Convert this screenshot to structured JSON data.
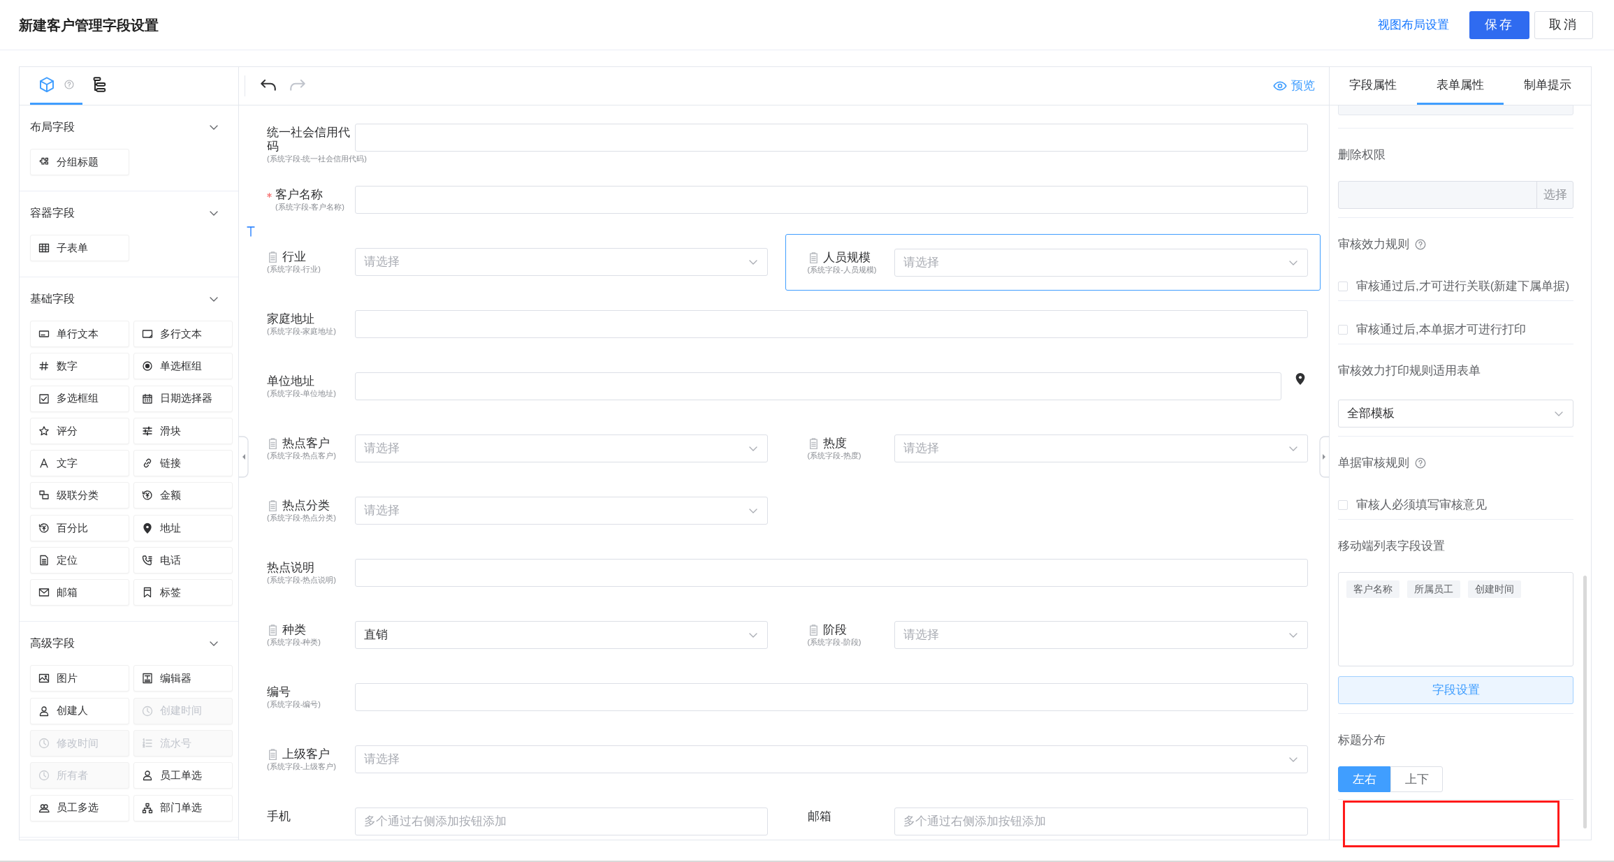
{
  "header": {
    "title": "新建客户管理字段设置",
    "actions": [
      {
        "label": "视图布局设置",
        "kind": "link"
      },
      {
        "label": "保存",
        "kind": "primary"
      },
      {
        "label": "取消",
        "kind": "default"
      }
    ]
  },
  "palette": {
    "tabs": [
      {
        "kind": "components",
        "selected": true
      },
      {
        "kind": "outline",
        "selected": false
      }
    ],
    "sections": [
      {
        "title": "布局字段",
        "expanded": true,
        "items": [
          {
            "label": "分组标题",
            "kind": "puzzle",
            "disabled": false
          }
        ]
      },
      {
        "title": "容器字段",
        "expanded": true,
        "items": [
          {
            "label": "子表单",
            "kind": "table",
            "disabled": false
          }
        ]
      },
      {
        "title": "基础字段",
        "expanded": true,
        "items": [
          {
            "label": "单行文本",
            "kind": "textline",
            "disabled": false
          },
          {
            "label": "多行文本",
            "kind": "textarea",
            "disabled": false
          },
          {
            "label": "数字",
            "kind": "number",
            "disabled": false
          },
          {
            "label": "单选框组",
            "kind": "radio",
            "disabled": false
          },
          {
            "label": "多选框组",
            "kind": "checkbox",
            "disabled": false
          },
          {
            "label": "日期选择器",
            "kind": "calendar",
            "disabled": false
          },
          {
            "label": "评分",
            "kind": "star",
            "disabled": false
          },
          {
            "label": "滑块",
            "kind": "sliders",
            "disabled": false
          },
          {
            "label": "文字",
            "kind": "font",
            "disabled": false
          },
          {
            "label": "链接",
            "kind": "link",
            "disabled": false
          },
          {
            "label": "级联分类",
            "kind": "cascade",
            "disabled": false
          },
          {
            "label": "金额",
            "kind": "money",
            "disabled": false
          },
          {
            "label": "百分比",
            "kind": "money",
            "disabled": false
          },
          {
            "label": "地址",
            "kind": "pin",
            "disabled": false
          },
          {
            "label": "定位",
            "kind": "document",
            "disabled": false
          },
          {
            "label": "电话",
            "kind": "phone",
            "disabled": false
          },
          {
            "label": "邮箱",
            "kind": "mail",
            "disabled": false
          },
          {
            "label": "标签",
            "kind": "bookmark",
            "disabled": false
          }
        ]
      },
      {
        "title": "高级字段",
        "expanded": true,
        "items": [
          {
            "label": "图片",
            "kind": "image",
            "disabled": false
          },
          {
            "label": "编辑器",
            "kind": "editor",
            "disabled": false
          },
          {
            "label": "创建人",
            "kind": "user",
            "disabled": false
          },
          {
            "label": "创建时间",
            "kind": "clock",
            "disabled": true
          },
          {
            "label": "修改时间",
            "kind": "clock",
            "disabled": true
          },
          {
            "label": "流水号",
            "kind": "numbered",
            "disabled": true
          },
          {
            "label": "所有者",
            "kind": "clock",
            "disabled": true
          },
          {
            "label": "员工单选",
            "kind": "user",
            "disabled": false
          },
          {
            "label": "员工多选",
            "kind": "users",
            "disabled": false
          },
          {
            "label": "部门单选",
            "kind": "org",
            "disabled": false
          }
        ]
      }
    ]
  },
  "canvas": {
    "preview": "预览",
    "rows": [
      [
        {
          "kind": "text",
          "full_width": true,
          "label": "统一社会信用代码",
          "note": "(系统字段-统一社会信用代码)",
          "required": false,
          "selected": false
        }
      ],
      [
        {
          "kind": "text",
          "full_width": true,
          "label": "客户名称",
          "note": "(系统字段-客户名称)",
          "required": true,
          "selected": false
        }
      ],
      [
        {
          "kind": "select",
          "full_width": false,
          "label": "行业",
          "note": "(系统字段-行业)",
          "placeholder": "请选择",
          "required": false,
          "selected": false
        },
        {
          "kind": "select",
          "full_width": false,
          "label": "人员规模",
          "note": "(系统字段-人员规模)",
          "placeholder": "请选择",
          "required": false,
          "selected": true
        }
      ],
      [
        {
          "kind": "text",
          "full_width": true,
          "label": "家庭地址",
          "note": "(系统字段-家庭地址)",
          "required": false,
          "selected": false
        }
      ],
      [
        {
          "kind": "address",
          "full_width": true,
          "label": "单位地址",
          "note": "(系统字段-单位地址)",
          "required": false,
          "selected": false
        }
      ],
      [
        {
          "kind": "select",
          "full_width": false,
          "label": "热点客户",
          "note": "(系统字段-热点客户)",
          "placeholder": "请选择",
          "required": false,
          "selected": false
        },
        {
          "kind": "select",
          "full_width": false,
          "label": "热度",
          "note": "(系统字段-热度)",
          "placeholder": "请选择",
          "required": false,
          "selected": false
        }
      ],
      [
        {
          "kind": "select",
          "full_width": false,
          "label": "热点分类",
          "note": "(系统字段-热点分类)",
          "placeholder": "请选择",
          "required": false,
          "selected": false
        }
      ],
      [
        {
          "kind": "text",
          "full_width": true,
          "label": "热点说明",
          "note": "(系统字段-热点说明)",
          "required": false,
          "selected": false
        }
      ],
      [
        {
          "kind": "select",
          "full_width": false,
          "label": "种类",
          "note": "(系统字段-种类)",
          "value": "直销",
          "required": false,
          "selected": false
        },
        {
          "kind": "select",
          "full_width": false,
          "label": "阶段",
          "note": "(系统字段-阶段)",
          "placeholder": "请选择",
          "required": false,
          "selected": false
        }
      ],
      [
        {
          "kind": "text",
          "full_width": true,
          "label": "编号",
          "note": "(系统字段-编号)",
          "required": false,
          "selected": false
        }
      ],
      [
        {
          "kind": "select",
          "full_width": true,
          "label": "上级客户",
          "note": "(系统字段-上级客户)",
          "placeholder": "请选择",
          "required": false,
          "selected": false
        }
      ],
      [
        {
          "kind": "text",
          "full_width": false,
          "label": "手机",
          "placeholder": "多个通过右侧添加按钮添加",
          "required": false,
          "selected": false
        },
        {
          "kind": "text",
          "full_width": false,
          "label": "邮箱",
          "placeholder": "多个通过右侧添加按钮添加",
          "required": false,
          "selected": false
        }
      ]
    ]
  },
  "properties": {
    "tabs": [
      {
        "label": "字段属性",
        "selected": false
      },
      {
        "label": "表单属性",
        "selected": true
      },
      {
        "label": "制单提示",
        "selected": false
      }
    ],
    "blocks": [
      {
        "kind": "title",
        "text": "删除权限",
        "help": false
      },
      {
        "kind": "addon-input",
        "addon": "选择"
      },
      {
        "kind": "title",
        "text": "审核效力规则",
        "help": true
      },
      {
        "kind": "checkbox",
        "text": "审核通过后,才可进行关联(新建下属单据)",
        "checked": false
      },
      {
        "kind": "checkbox",
        "text": "审核通过后,本单据才可进行打印",
        "checked": false
      },
      {
        "kind": "title",
        "text": "审核效力打印规则适用表单",
        "help": false
      },
      {
        "kind": "select",
        "value": "全部模板"
      },
      {
        "kind": "title",
        "text": "单据审核规则",
        "help": true
      },
      {
        "kind": "checkbox",
        "text": "审核人必须填写审核意见",
        "checked": false
      },
      {
        "kind": "title",
        "text": "移动端列表字段设置",
        "help": false
      },
      {
        "kind": "tags",
        "tags": [
          "客户名称",
          "所属员工",
          "创建时间"
        ]
      },
      {
        "kind": "button",
        "text": "字段设置"
      },
      {
        "kind": "title",
        "text": "标题分布",
        "help": false
      },
      {
        "kind": "segmented",
        "options": [
          {
            "label": "左右",
            "selected": true
          },
          {
            "label": "上下",
            "selected": false
          }
        ]
      }
    ]
  }
}
